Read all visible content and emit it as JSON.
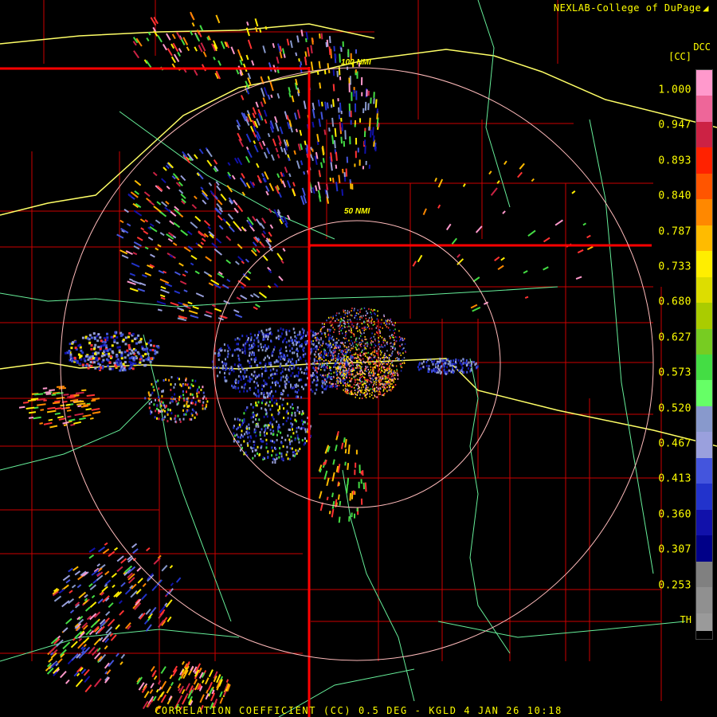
{
  "header": {
    "credit": "NEXLAB-College of DuPage",
    "credit_icon": "logo-glyph-icon",
    "product_code": "DCC",
    "unit": "[CC]"
  },
  "rings": [
    {
      "label": "100 NMI"
    },
    {
      "label": "50 NMI"
    }
  ],
  "scale": {
    "ticks": [
      "1.000",
      "0.947",
      "0.893",
      "0.840",
      "0.787",
      "0.733",
      "0.680",
      "0.627",
      "0.573",
      "0.520",
      "0.467",
      "0.413",
      "0.360",
      "0.307",
      "0.253"
    ],
    "threshold_label": "TH",
    "colors": [
      "#ff99cc",
      "#ee6699",
      "#cc2244",
      "#ff2200",
      "#ff5500",
      "#ff8800",
      "#ffbb00",
      "#ffee00",
      "#dddd00",
      "#aacc00",
      "#77cc22",
      "#44dd44",
      "#66ff66",
      "#8899cc",
      "#9aa0dd",
      "#4455dd",
      "#2233cc",
      "#1111aa",
      "#000088",
      "#808080",
      "#909090",
      "#9a9a9a"
    ]
  },
  "caption": "CORRELATION COEFFICIENT (CC) 0.5 DEG - KGLD 4 JAN 26 10:18",
  "colors": {
    "text": "#ffff00",
    "state_border": "#ff0000",
    "county_border": "#cc0000",
    "highway": "#ffff66",
    "road": "#66ee99",
    "range_ring": "#ffbbbb"
  }
}
